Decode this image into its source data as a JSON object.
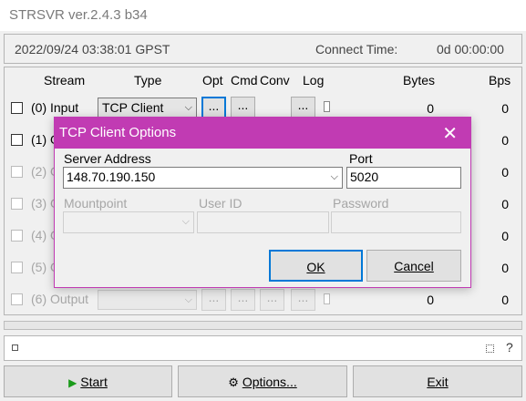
{
  "window": {
    "title": "STRSVR ver.2.4.3 b34"
  },
  "status_bar": {
    "datetime": "2022/09/24 03:38:01 GPST",
    "connect_label": "Connect Time:",
    "connect_value": "0d 00:00:00"
  },
  "table": {
    "headers": {
      "stream": "Stream",
      "type": "Type",
      "opt": "Opt",
      "cmd": "Cmd",
      "conv": "Conv",
      "log": "Log",
      "bytes": "Bytes",
      "bps": "Bps"
    },
    "button_label": "...",
    "rows": [
      {
        "label": "(0) Input",
        "type": "TCP Client",
        "bytes": "0",
        "bps": "0"
      },
      {
        "label": "(1) O",
        "bytes": "0",
        "bps": "0"
      },
      {
        "label": "(2) O",
        "bytes": "0",
        "bps": "0"
      },
      {
        "label": "(3) O",
        "bytes": "0",
        "bps": "0"
      },
      {
        "label": "(4) O",
        "bytes": "0",
        "bps": "0"
      },
      {
        "label": "(5) O",
        "bytes": "0",
        "bps": "0"
      },
      {
        "label": "(6) Output",
        "type": "",
        "bytes": "0",
        "bps": "0"
      }
    ]
  },
  "message_bar": {
    "text": ""
  },
  "buttons": {
    "start": "Start",
    "options": "Options...",
    "exit": "Exit"
  },
  "dialog": {
    "title": "TCP Client Options",
    "server_address_label": "Server Address",
    "server_address_value": "148.70.190.150",
    "port_label": "Port",
    "port_value": "5020",
    "mountpoint_label": "Mountpoint",
    "user_id_label": "User ID",
    "password_label": "Password",
    "ok": "OK",
    "cancel": "Cancel"
  },
  "colors": {
    "dialog_accent": "#c13bb3",
    "start_icon": "#1a9b1a"
  },
  "icons": [
    "close-icon",
    "play-icon",
    "gear-icon",
    "chevron-down-icon"
  ]
}
